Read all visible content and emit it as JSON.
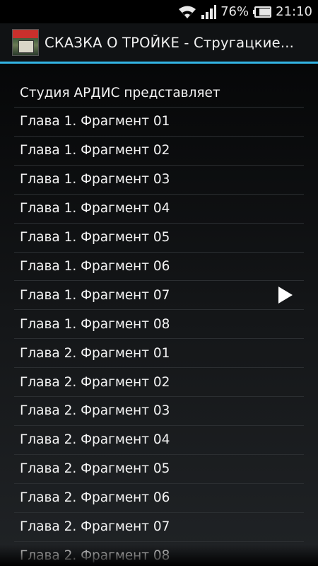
{
  "status_bar": {
    "battery_percent": "76%",
    "time": "21:10",
    "icons": [
      "wifi-icon",
      "signal-icon",
      "battery-icon"
    ]
  },
  "action_bar": {
    "title": "СКАЗКА О ТРОЙКЕ  -  Стругацкие...",
    "icon": "app-icon"
  },
  "list": {
    "items": [
      {
        "label": "Студия АРДИС представляет",
        "playing": false
      },
      {
        "label": "Глава 1. Фрагмент 01",
        "playing": false
      },
      {
        "label": "Глава 1. Фрагмент 02",
        "playing": false
      },
      {
        "label": "Глава 1. Фрагмент 03",
        "playing": false
      },
      {
        "label": "Глава 1. Фрагмент 04",
        "playing": false
      },
      {
        "label": "Глава 1. Фрагмент 05",
        "playing": false
      },
      {
        "label": "Глава 1. Фрагмент 06",
        "playing": false
      },
      {
        "label": "Глава 1. Фрагмент 07",
        "playing": true
      },
      {
        "label": "Глава 1. Фрагмент 08",
        "playing": false
      },
      {
        "label": "Глава 2. Фрагмент 01",
        "playing": false
      },
      {
        "label": "Глава 2. Фрагмент 02",
        "playing": false
      },
      {
        "label": "Глава 2. Фрагмент 03",
        "playing": false
      },
      {
        "label": "Глава 2. Фрагмент 04",
        "playing": false
      },
      {
        "label": "Глава 2. Фрагмент 05",
        "playing": false
      },
      {
        "label": "Глава 2. Фрагмент 06",
        "playing": false
      },
      {
        "label": "Глава 2. Фрагмент 07",
        "playing": false
      },
      {
        "label": "Глава 2. Фрагмент 08",
        "playing": false
      }
    ]
  },
  "colors": {
    "accent": "#33b5e5",
    "background": "#000000"
  }
}
